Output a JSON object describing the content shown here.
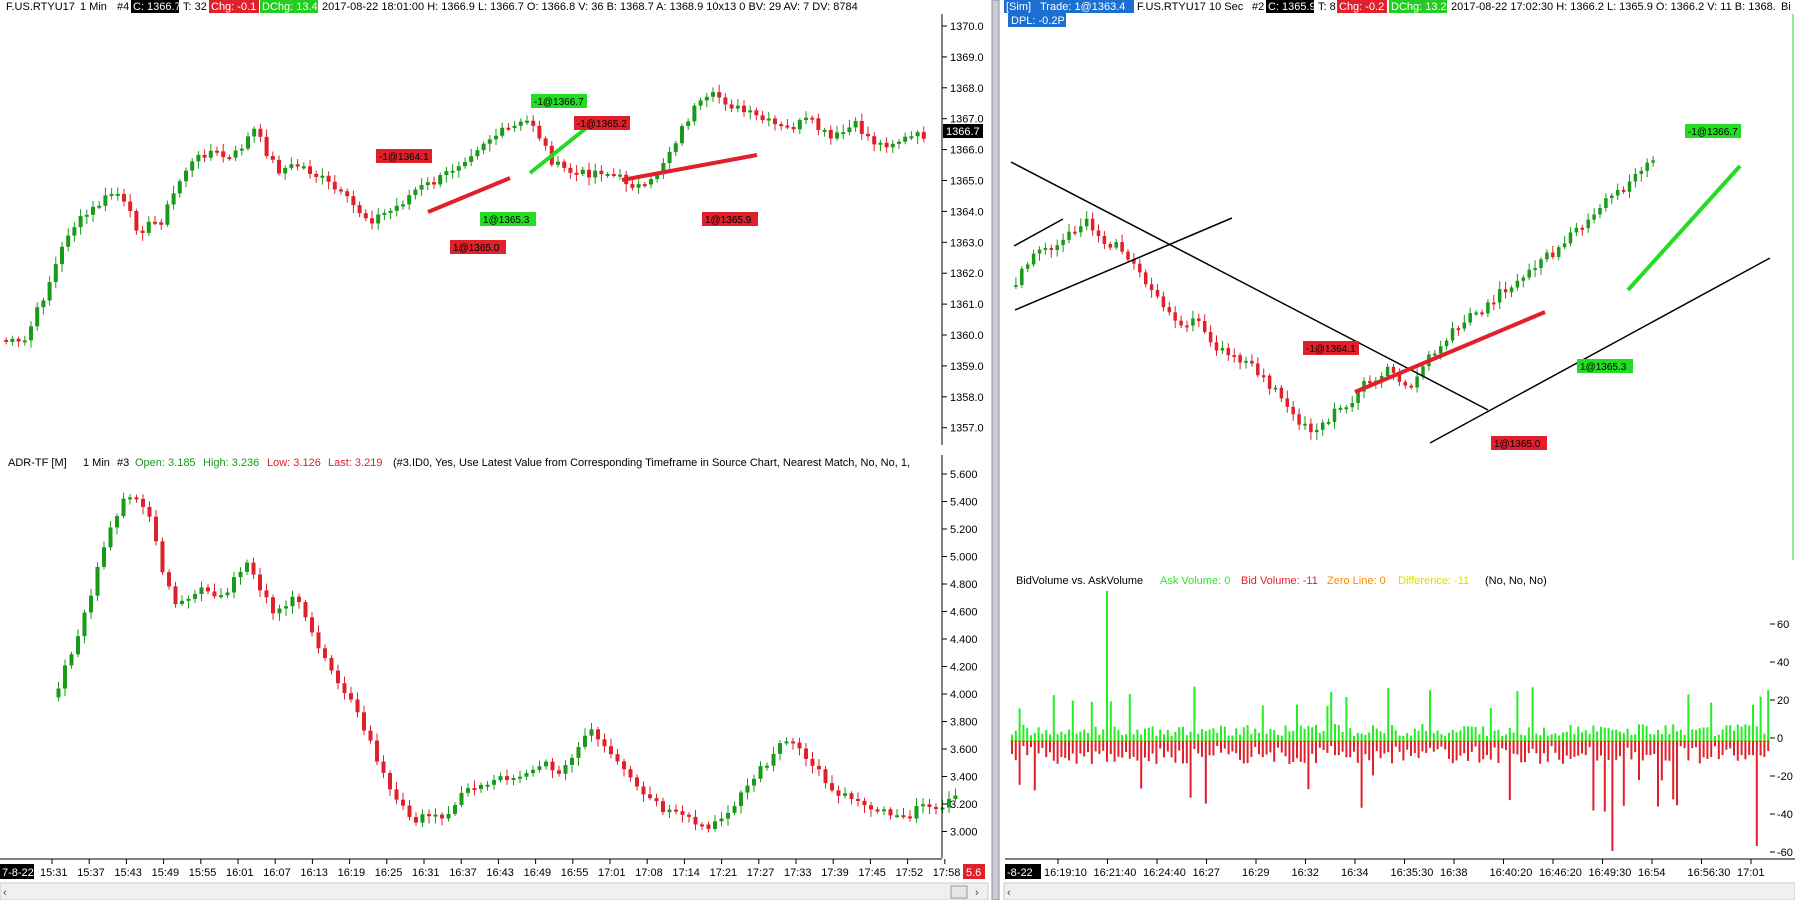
{
  "left": {
    "header": {
      "symbol": "F.US.RTYU17",
      "interval": "1 Min",
      "chart_no": "#4",
      "close": "C: 1366.7",
      "ticks": "T: 32",
      "chg": "Chg: -0.1",
      "dchg": "DChg: 13.4",
      "rest": "2017-08-22 18:01:00 H: 1366.9 L: 1366.7 O: 1366.8 V: 36 B: 1368.7 A: 1368.9 10x13 0 BV: 29 AV: 7 DV: 8784"
    },
    "price_axis": [
      "1370.0",
      "1369.0",
      "1368.0",
      "1367.0",
      "1366.0",
      "1365.0",
      "1364.0",
      "1363.0",
      "1362.0",
      "1361.0",
      "1360.0",
      "1359.0",
      "1358.0",
      "1357.0"
    ],
    "last_price": "1366.7",
    "trades": [
      {
        "label": "-1@1364.1",
        "color": "#e0202a",
        "time": 18.5,
        "price": 1364.1
      },
      {
        "label": "1@1365.0",
        "color": "#e0202a",
        "time": 24.0,
        "price": 1365.0
      },
      {
        "label": "1@1365.3",
        "color": "#22dd22",
        "time": 26.5,
        "price": 1365.3
      },
      {
        "label": "-1@1366.7",
        "color": "#22dd22",
        "time": 31.5,
        "price": 1366.7
      },
      {
        "label": "-1@1365.2",
        "color": "#e0202a",
        "time": 34.0,
        "price": 1365.2
      },
      {
        "label": "1@1365.9",
        "color": "#e0202a",
        "time": 51.0,
        "price": 1365.9
      }
    ],
    "indicator": {
      "name": "ADR-TF [M]",
      "interval": "1 Min",
      "chart_no": "#3",
      "open": "Open: 3.185",
      "high": "High: 3.236",
      "low": "Low: 3.126",
      "last": "Last: 3.219",
      "params": "(#3.ID0, Yes, Use Latest Value from Corresponding Timeframe in Source Chart, Nearest Match, No, No, 1,"
    },
    "ind_axis": [
      "5.600",
      "5.400",
      "5.200",
      "5.000",
      "4.800",
      "4.600",
      "4.400",
      "4.200",
      "4.000",
      "3.800",
      "3.600",
      "3.400",
      "3.200",
      "3.000"
    ],
    "time_date": "7-8-22",
    "time_axis": [
      "15:31",
      "15:37",
      "15:43",
      "15:49",
      "15:55",
      "16:01",
      "16:07",
      "16:13",
      "16:19",
      "16:25",
      "16:31",
      "16:37",
      "16:43",
      "16:49",
      "16:55",
      "17:01",
      "17:08",
      "17:14",
      "17:21",
      "17:27",
      "17:33",
      "17:39",
      "17:45",
      "17:52",
      "17:58"
    ],
    "corner_label": "5.6"
  },
  "right": {
    "header": {
      "sim": "[Sim]",
      "trade": "Trade: 1@1363.4",
      "symbol": "F.US.RTYU17",
      "interval": "10 Sec",
      "chart_no": "#2",
      "close": "C: 1365.9",
      "ticks": "T: 8",
      "chg": "Chg: -0.2",
      "dchg": "DChg: 13.2",
      "rest": "2017-08-22 17:02:30 H: 1366.2 L: 1365.9 O: 1366.2 V: 11 B: 1368.",
      "dpl": "DPL: -0.2P"
    },
    "trades": [
      {
        "label": "-1@1364.1",
        "color": "#e0202a"
      },
      {
        "label": "1@1365.3",
        "color": "#22dd22"
      },
      {
        "label": "1@1365.0",
        "color": "#e0202a"
      },
      {
        "label": "-1@1366.7",
        "color": "#22dd22"
      }
    ],
    "volume_header": {
      "name": "BidVolume vs. AskVolume",
      "ask": "Ask Volume: 0",
      "bid": "Bid Volume: -11",
      "zero": "Zero Line: 0",
      "diff": "Difference: -11",
      "params": "(No, No, No)"
    },
    "vol_axis": [
      "60",
      "40",
      "20",
      "0",
      "-20",
      "-40",
      "-60"
    ],
    "time_date": "-8-22",
    "time_axis": [
      "16:19:10",
      "16:21:40",
      "16:24:40",
      "16:27",
      "16:29",
      "16:32",
      "16:34",
      "16:35:30",
      "16:38",
      "16:40:20",
      "16:46:20",
      "16:49:30",
      "16:54",
      "16:56:30",
      "17:01"
    ],
    "corner_label": "Bi"
  },
  "colors": {
    "up": "#1a9a1a",
    "down": "#e0202a",
    "ask": "#22ee22",
    "bid": "#e0202a",
    "zero": "#ff8800",
    "diff": "#dddd00"
  }
}
